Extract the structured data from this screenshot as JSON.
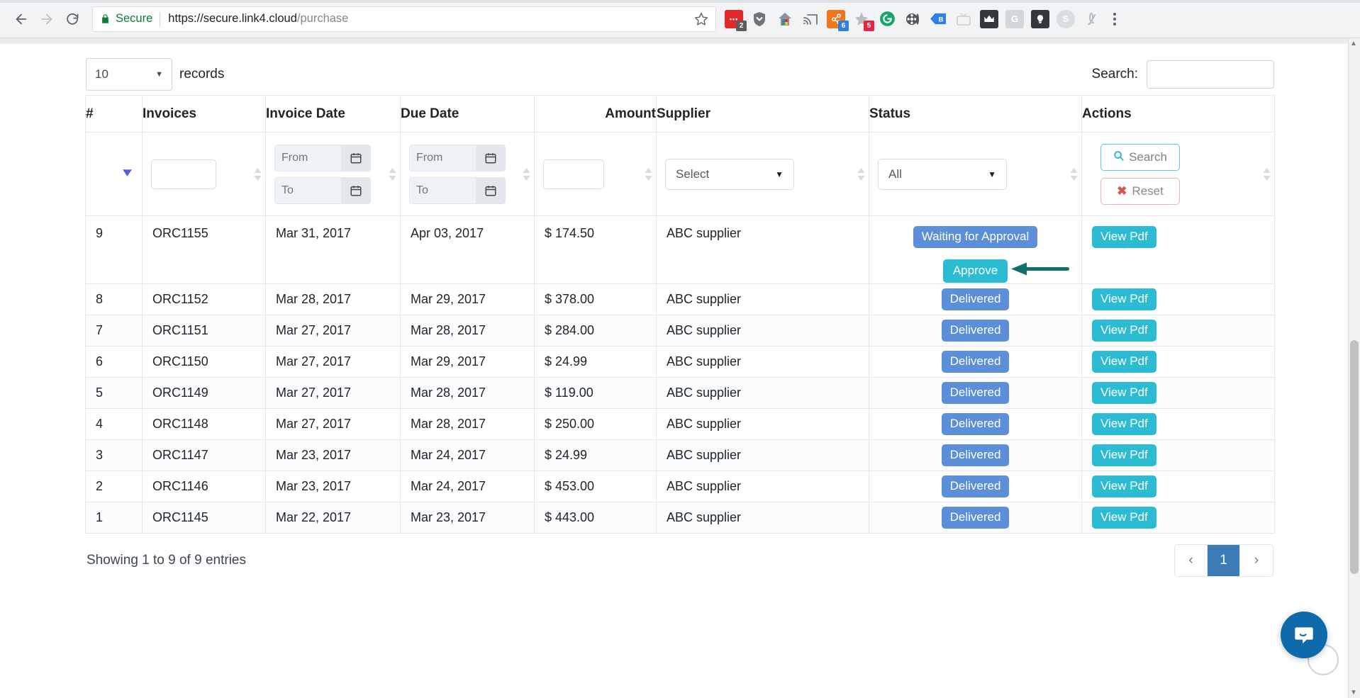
{
  "browser": {
    "back_label": "Back",
    "forward_label": "Forward",
    "reload_label": "Reload",
    "security_label": "Secure",
    "url_host": "https://secure.link4.cloud",
    "url_path": "/purchase",
    "bookmark_label": "Bookmark this page",
    "extensions": [
      {
        "name": "pocket-red-extension",
        "glyph": "•••",
        "bg": "#e3282e",
        "badge": "2",
        "badge_bg": "#5c5c5c"
      },
      {
        "name": "shield-extension",
        "glyph": "▼",
        "bg": "#6f7479",
        "badge": "",
        "badge_bg": ""
      },
      {
        "name": "house-colored-extension",
        "glyph": "⌂",
        "bg": "#ffffff",
        "badge": "",
        "badge_bg": ""
      },
      {
        "name": "cast-extension",
        "glyph": "⬜",
        "bg": "#ffffff",
        "badge": "",
        "badge_bg": ""
      },
      {
        "name": "hubspot-extension",
        "glyph": "✶",
        "bg": "#f2761b",
        "badge": "6",
        "badge_bg": "#2f7fe0"
      },
      {
        "name": "grey-star-extension",
        "glyph": "✶",
        "bg": "#b7bcc2",
        "badge": "5",
        "badge_bg": "#e8253e"
      },
      {
        "name": "grammarly-extension",
        "glyph": "G",
        "bg": "#15a66a",
        "badge": "",
        "badge_bg": ""
      },
      {
        "name": "film-reel-extension",
        "glyph": "◉",
        "bg": "#ffffff",
        "badge": "",
        "badge_bg": ""
      },
      {
        "name": "blue-tag-extension",
        "glyph": "B",
        "bg": "#2d7ff0",
        "badge": "",
        "badge_bg": ""
      },
      {
        "name": "tv-extension",
        "glyph": "▭",
        "bg": "#ffffff",
        "badge": "",
        "badge_bg": ""
      },
      {
        "name": "crown-extension",
        "glyph": "♛",
        "bg": "#34383c",
        "badge": "",
        "badge_bg": ""
      },
      {
        "name": "google-g-extension",
        "glyph": "G",
        "bg": "#d4d7da",
        "badge": "",
        "badge_bg": ""
      },
      {
        "name": "lightbulb-extension",
        "glyph": "●",
        "bg": "#34383c",
        "badge": "",
        "badge_bg": ""
      },
      {
        "name": "skype-extension",
        "glyph": "S",
        "bg": "#dadde0",
        "badge": "",
        "badge_bg": ""
      },
      {
        "name": "signature-extension",
        "glyph": "⫽",
        "bg": "#ffffff",
        "badge": "",
        "badge_bg": ""
      }
    ],
    "menu_label": "Customize and control Google Chrome"
  },
  "toolbar": {
    "page_length_value": "10",
    "page_length_caret": "▼",
    "records_label": "records",
    "search_label": "Search:",
    "search_value": "",
    "search_placeholder": ""
  },
  "table": {
    "headers": {
      "num": "#",
      "invoices": "Invoices",
      "invoice_date": "Invoice Date",
      "due_date": "Due Date",
      "amount": "Amount",
      "supplier": "Supplier",
      "status": "Status",
      "actions": "Actions"
    },
    "filters": {
      "invoice_value": "",
      "invoice_placeholder": "",
      "invoice_date_from_placeholder": "From",
      "invoice_date_to_placeholder": "To",
      "due_date_from_placeholder": "From",
      "due_date_to_placeholder": "To",
      "amount_value": "",
      "amount_placeholder": "",
      "supplier_selected": "Select",
      "supplier_caret": "▼",
      "status_selected": "All",
      "status_caret": "▼",
      "search_button": "Search",
      "reset_button": "Reset",
      "reset_glyph": "✖"
    },
    "rows": [
      {
        "num": "9",
        "invoice": "ORC1155",
        "invoice_date": "Mar 31, 2017",
        "due_date": "Apr 03, 2017",
        "amount": "$ 174.50",
        "supplier": "ABC supplier",
        "status": "Waiting for Approval",
        "status_style": "blue",
        "approve_label": "Approve",
        "action": "View Pdf",
        "annotated": true
      },
      {
        "num": "8",
        "invoice": "ORC1152",
        "invoice_date": "Mar 28, 2017",
        "due_date": "Mar 29, 2017",
        "amount": "$ 378.00",
        "supplier": "ABC supplier",
        "status": "Delivered",
        "status_style": "blue",
        "approve_label": "",
        "action": "View Pdf",
        "annotated": false
      },
      {
        "num": "7",
        "invoice": "ORC1151",
        "invoice_date": "Mar 27, 2017",
        "due_date": "Mar 28, 2017",
        "amount": "$ 284.00",
        "supplier": "ABC supplier",
        "status": "Delivered",
        "status_style": "blue",
        "approve_label": "",
        "action": "View Pdf",
        "annotated": false
      },
      {
        "num": "6",
        "invoice": "ORC1150",
        "invoice_date": "Mar 27, 2017",
        "due_date": "Mar 29, 2017",
        "amount": "$ 24.99",
        "supplier": "ABC supplier",
        "status": "Delivered",
        "status_style": "blue",
        "approve_label": "",
        "action": "View Pdf",
        "annotated": false
      },
      {
        "num": "5",
        "invoice": "ORC1149",
        "invoice_date": "Mar 27, 2017",
        "due_date": "Mar 28, 2017",
        "amount": "$ 119.00",
        "supplier": "ABC supplier",
        "status": "Delivered",
        "status_style": "blue",
        "approve_label": "",
        "action": "View Pdf",
        "annotated": false
      },
      {
        "num": "4",
        "invoice": "ORC1148",
        "invoice_date": "Mar 27, 2017",
        "due_date": "Mar 28, 2017",
        "amount": "$ 250.00",
        "supplier": "ABC supplier",
        "status": "Delivered",
        "status_style": "blue",
        "approve_label": "",
        "action": "View Pdf",
        "annotated": false
      },
      {
        "num": "3",
        "invoice": "ORC1147",
        "invoice_date": "Mar 23, 2017",
        "due_date": "Mar 24, 2017",
        "amount": "$ 24.99",
        "supplier": "ABC supplier",
        "status": "Delivered",
        "status_style": "blue",
        "approve_label": "",
        "action": "View Pdf",
        "annotated": false
      },
      {
        "num": "2",
        "invoice": "ORC1146",
        "invoice_date": "Mar 23, 2017",
        "due_date": "Mar 24, 2017",
        "amount": "$ 453.00",
        "supplier": "ABC supplier",
        "status": "Delivered",
        "status_style": "blue",
        "approve_label": "",
        "action": "View Pdf",
        "annotated": false
      },
      {
        "num": "1",
        "invoice": "ORC1145",
        "invoice_date": "Mar 22, 2017",
        "due_date": "Mar 23, 2017",
        "amount": "$ 443.00",
        "supplier": "ABC supplier",
        "status": "Delivered",
        "status_style": "blue",
        "approve_label": "",
        "action": "View Pdf",
        "annotated": false
      }
    ]
  },
  "footer": {
    "entries_info": "Showing 1 to 9 of 9 entries",
    "prev_label": "‹",
    "page_1": "1",
    "next_label": "›"
  },
  "widgets": {
    "chat_label": "Open chat"
  },
  "colors": {
    "badge_blue": "#5b8fda",
    "badge_teal": "#2bbcd4",
    "pager_active": "#3b7cb9",
    "annotation_arrow": "#11706b",
    "secure_green": "#0f7b34",
    "search_btn_border": "#5bc8d8",
    "reset_btn_border": "#e3b7bb",
    "reset_glyph": "#d9534f",
    "sort_active": "#5a5ad4",
    "intercom_blue": "#0f6aab"
  }
}
